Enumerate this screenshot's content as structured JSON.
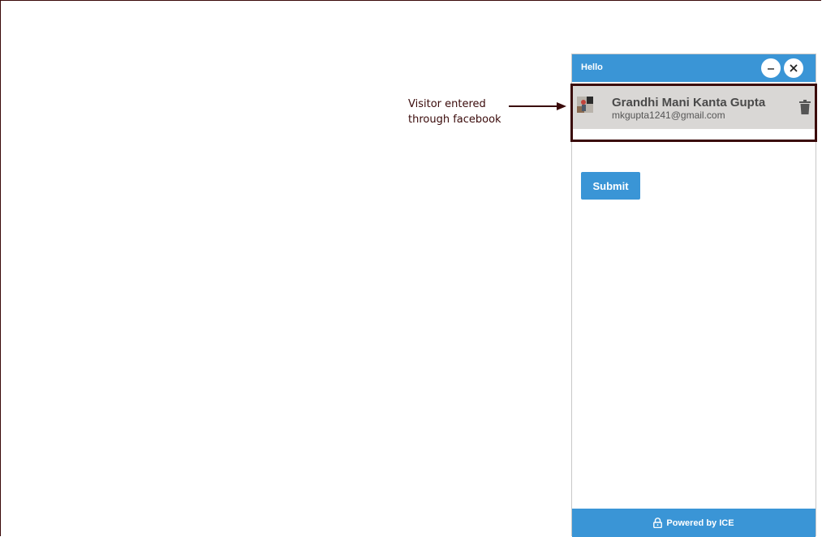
{
  "annotation": {
    "line1": "Visitor entered",
    "line2": "through facebook"
  },
  "widget": {
    "title": "Hello",
    "minimize_icon": "minimize-icon",
    "close_icon": "close-icon",
    "visitor": {
      "name": "Grandhi Mani Kanta Gupta",
      "email": "mkgupta1241@gmail.com",
      "delete_icon": "trash-icon"
    },
    "submit_label": "Submit",
    "footer": {
      "text": "Powered by ICE",
      "icon": "lock-icon"
    }
  },
  "colors": {
    "accent": "#3a95d6",
    "annotation": "#3a0a0a",
    "visitor_bg": "#d9d7d5"
  }
}
